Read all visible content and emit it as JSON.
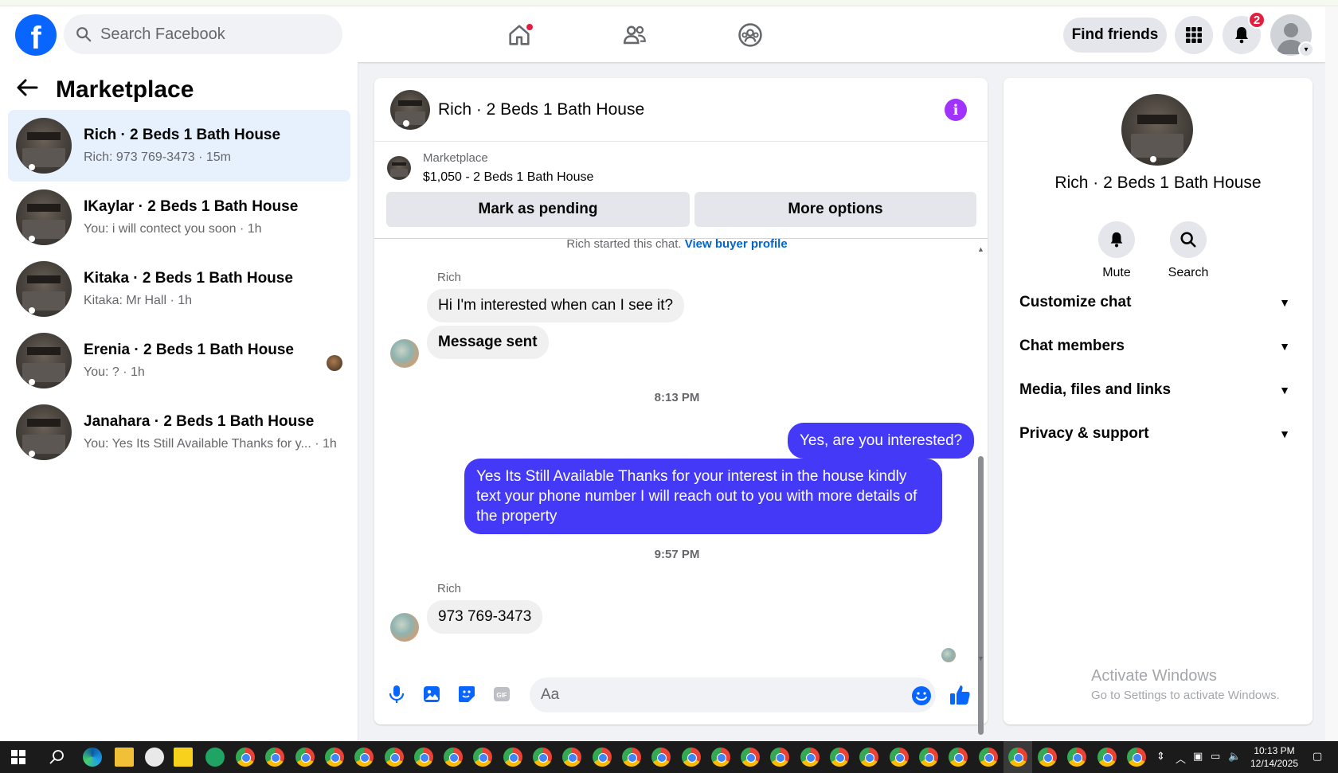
{
  "topbar": {
    "search_placeholder": "Search Facebook",
    "find_friends_label": "Find friends",
    "notification_count": "2",
    "logo_letter": "f"
  },
  "left": {
    "title": "Marketplace",
    "conversations": [
      {
        "title": "Rich · 2 Beds 1 Bath House",
        "subtitle": "Rich: 973 769-3473 · 15m"
      },
      {
        "title": "IKaylar · 2 Beds 1 Bath House",
        "subtitle": "You: i will contect you soon · 1h"
      },
      {
        "title": "Kitaka · 2 Beds 1 Bath House",
        "subtitle": "Kitaka: Mr Hall · 1h"
      },
      {
        "title": "Erenia · 2 Beds 1 Bath House",
        "subtitle": "You: ? · 1h"
      },
      {
        "title": "Janahara · 2 Beds 1 Bath House",
        "subtitle": "You: Yes Its Still Available Thanks for y... · 1h"
      }
    ]
  },
  "chat": {
    "title": "Rich · 2 Beds 1 Bath House",
    "listing_label": "Marketplace",
    "listing_price": "$1,050 - 2 Beds 1 Bath House",
    "mark_pending_label": "Mark as pending",
    "more_options_label": "More options",
    "started_text": "Rich started this chat.",
    "buyer_profile_link": "View buyer profile",
    "messages": {
      "sender1": "Rich",
      "in1": "Hi I'm interested when can I see it?",
      "in2": "Message sent",
      "time1": "8:13 PM",
      "out1": "Yes, are you interested?",
      "out2": "Yes Its Still Available Thanks for your interest in the house kindly text your phone number I will reach out to you with more details of the property",
      "time2": "9:57 PM",
      "sender2": "Rich",
      "in3": "973 769-3473"
    },
    "composer_placeholder": "Aa"
  },
  "right": {
    "name": "Rich · 2 Beds 1 Bath House",
    "mute_label": "Mute",
    "search_label": "Search",
    "sections": [
      "Customize chat",
      "Chat members",
      "Media, files and links",
      "Privacy & support"
    ],
    "activate_title": "Activate Windows",
    "activate_sub": "Go to Settings to activate Windows."
  },
  "taskbar": {
    "time": "10:13 PM",
    "date": "12/14/2025"
  },
  "colors": {
    "brand": "#0866ff",
    "outgoing_bubble": "#4439f7",
    "active_conversation": "#e7f0fd",
    "notification_red": "#e41e3f",
    "info_purple": "#a033ff"
  }
}
